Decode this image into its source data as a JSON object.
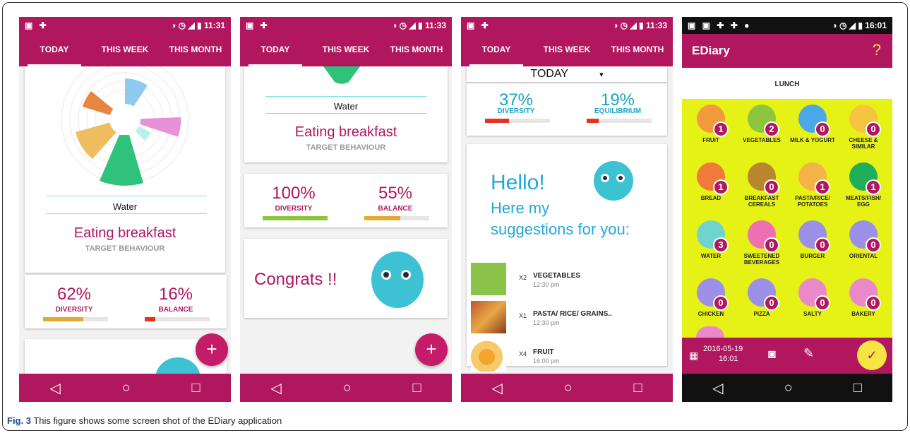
{
  "colors": {
    "brand": "#b0175e",
    "yellow": "#e6f216",
    "teal": "#3cc2d3"
  },
  "status": {
    "icons_left": "▣ ✚",
    "icons_right": "◑ ◷ ◢ ▮",
    "time1": "11:31",
    "time2": "11:33",
    "time3": "11:33",
    "time4": "16:01",
    "icons_left4": "▣ ▣ ✚ ✚ ●"
  },
  "tabs": [
    "TODAY",
    "THIS WEEK",
    "THIS MONTH"
  ],
  "nav": {
    "back": "◁",
    "home": "○",
    "recent": "□"
  },
  "screen1": {
    "water": "Water",
    "behaviour": "Eating breakfast",
    "target": "TARGET BEHAVIOUR",
    "diversity_pct": "62%",
    "diversity_label": "DIVERSITY",
    "balance_pct": "16%",
    "balance_label": "BALANCE",
    "diversity_fill": 0.62,
    "balance_fill": 0.16,
    "fab": "+"
  },
  "screen2": {
    "water": "Water",
    "behaviour": "Eating breakfast",
    "target": "TARGET BEHAVIOUR",
    "diversity_pct": "100%",
    "diversity_label": "DIVERSITY",
    "balance_pct": "55%",
    "balance_label": "BALANCE",
    "diversity_fill": 1.0,
    "balance_fill": 0.55,
    "congrats": "Congrats !!",
    "fab": "+"
  },
  "screen3": {
    "period": "TODAY",
    "caret": "▾",
    "diversity_pct": "37%",
    "diversity_label": "DIVERSITY",
    "equilibrium_pct": "19%",
    "equilibrium_label": "EQUILIBRIUM",
    "diversity_fill": 0.37,
    "equilibrium_fill": 0.19,
    "hello": "Hello!",
    "here": "Here my",
    "suggestions": "suggestions for you:",
    "items": [
      {
        "qty": "X2",
        "name": "VEGETABLES",
        "time": "12:30 pm"
      },
      {
        "qty": "X1",
        "name": "PASTA/ RICE/ GRAINS..",
        "time": "12:30 pm"
      },
      {
        "qty": "X4",
        "name": "FRUIT",
        "time": "16:00 pm"
      }
    ]
  },
  "screen4": {
    "title": "EDiary",
    "help": "?",
    "meal": "LUNCH",
    "date": "2016-05-19",
    "time": "16:01",
    "camera": "◙",
    "pencil": "✎",
    "check": "✓",
    "categories": [
      {
        "name": "FRUIT",
        "count": "1",
        "color": "#f19a3e"
      },
      {
        "name": "VEGETABLES",
        "count": "2",
        "color": "#8cc63f"
      },
      {
        "name": "MILK & YOGURT",
        "count": "0",
        "color": "#4aa8e8"
      },
      {
        "name": "CHEESE & SIMILAR",
        "count": "0",
        "color": "#f5c542"
      },
      {
        "name": "BREAD",
        "count": "1",
        "color": "#f07a3a"
      },
      {
        "name": "BREAKFAST CEREALS",
        "count": "0",
        "color": "#b8862d"
      },
      {
        "name": "PASTA/RICE/ POTATOES",
        "count": "1",
        "color": "#f4b24a"
      },
      {
        "name": "MEATS/FISH/ EGG",
        "count": "1",
        "color": "#1fae5a"
      },
      {
        "name": "WATER",
        "count": "3",
        "color": "#6fd3cf"
      },
      {
        "name": "SWEETENED BEVERAGES",
        "count": "0",
        "color": "#ef6fb0"
      },
      {
        "name": "BURGER",
        "count": "0",
        "color": "#9c8fe8"
      },
      {
        "name": "ORIENTAL",
        "count": "0",
        "color": "#9c8fe8"
      },
      {
        "name": "CHICKEN",
        "count": "0",
        "color": "#9c8fe8"
      },
      {
        "name": "PIZZA",
        "count": "0",
        "color": "#9c8fe8"
      },
      {
        "name": "SALTY",
        "count": "0",
        "color": "#e989c9"
      },
      {
        "name": "BAKERY",
        "count": "0",
        "color": "#e989c9"
      }
    ]
  },
  "caption": {
    "fig": "Fig. 3",
    "text": " This figure shows some screen shot of the EDiary application"
  }
}
